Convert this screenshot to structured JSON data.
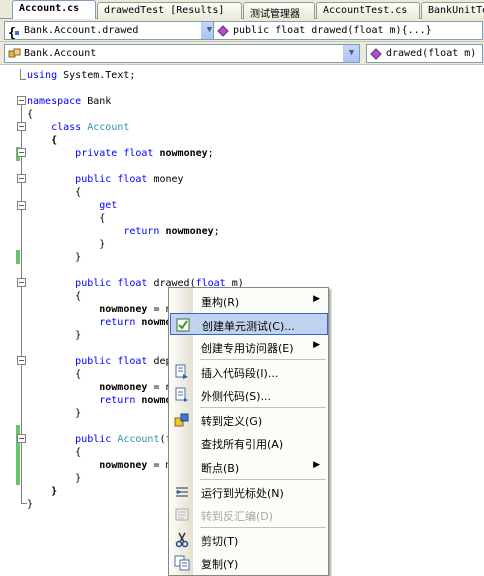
{
  "tabs": [
    {
      "label": "Account.cs",
      "active": true
    },
    {
      "label": "drawedTest [Results]",
      "active": false
    },
    {
      "label": "测试管理器",
      "active": false
    },
    {
      "label": "AccountTest.cs",
      "active": false
    },
    {
      "label": "BankUnitTe",
      "active": false
    }
  ],
  "nav_top": {
    "class_combo": "Bank.Account.drawed",
    "member_combo": "public float drawed(float m){...}"
  },
  "nav_bottom": {
    "type_combo": "Bank.Account",
    "method_combo": "drawed(float m)"
  },
  "code_lines": [
    "using System.Text;",
    "",
    "namespace Bank",
    "{",
    "    class Account",
    "    {",
    "        private float nowmoney;",
    "",
    "        public float money",
    "        {",
    "            get",
    "            {",
    "                return nowmoney;",
    "            }",
    "        }",
    "",
    "        public float drawed(float m)",
    "        {",
    "            nowmoney = n",
    "            return nowmo",
    "        }",
    "",
    "        public float dep",
    "        {",
    "            nowmoney = n",
    "            return nowmo",
    "        }",
    "",
    "        public Account(f",
    "        {",
    "            nowmoney = m",
    "        }",
    "    }",
    "}"
  ],
  "context_menu": {
    "items": [
      {
        "label": "重构(R)",
        "submenu": true,
        "icon": "none"
      },
      {
        "label": "创建单元测试(C)...",
        "highlighted": true,
        "icon": "unit-test-icon"
      },
      {
        "label": "创建专用访问器(E)",
        "submenu": true,
        "icon": "none"
      },
      {
        "label": "插入代码段(I)...",
        "icon": "insert-snippet-icon"
      },
      {
        "label": "外侧代码(S)...",
        "icon": "surround-with-icon"
      },
      {
        "label": "转到定义(G)",
        "icon": "go-to-definition-icon"
      },
      {
        "label": "查找所有引用(A)",
        "icon": "none"
      },
      {
        "label": "断点(B)",
        "submenu": true,
        "icon": "none"
      },
      {
        "label": "运行到光标处(N)",
        "icon": "run-to-cursor-icon"
      },
      {
        "label": "转到反汇编(D)",
        "disabled": true,
        "icon": "disassembly-icon"
      },
      {
        "label": "剪切(T)",
        "icon": "cut-icon"
      },
      {
        "label": "复制(Y)",
        "icon": "copy-icon"
      }
    ],
    "submenu_arrow": "▶"
  },
  "icons": {
    "class_combo_icon": "class-braces-icon",
    "member_combo_icon": "method-icon",
    "type_combo_icon": "type-icon",
    "method_combo_icon": "method-icon",
    "dropdown": "chevron-down-icon"
  },
  "colors": {
    "keyword": "#0000ff",
    "type": "#2b91af",
    "change_bar": "#6ac36a",
    "menu_highlight": "#c1d2ee",
    "menu_highlight_border": "#316ac5"
  }
}
